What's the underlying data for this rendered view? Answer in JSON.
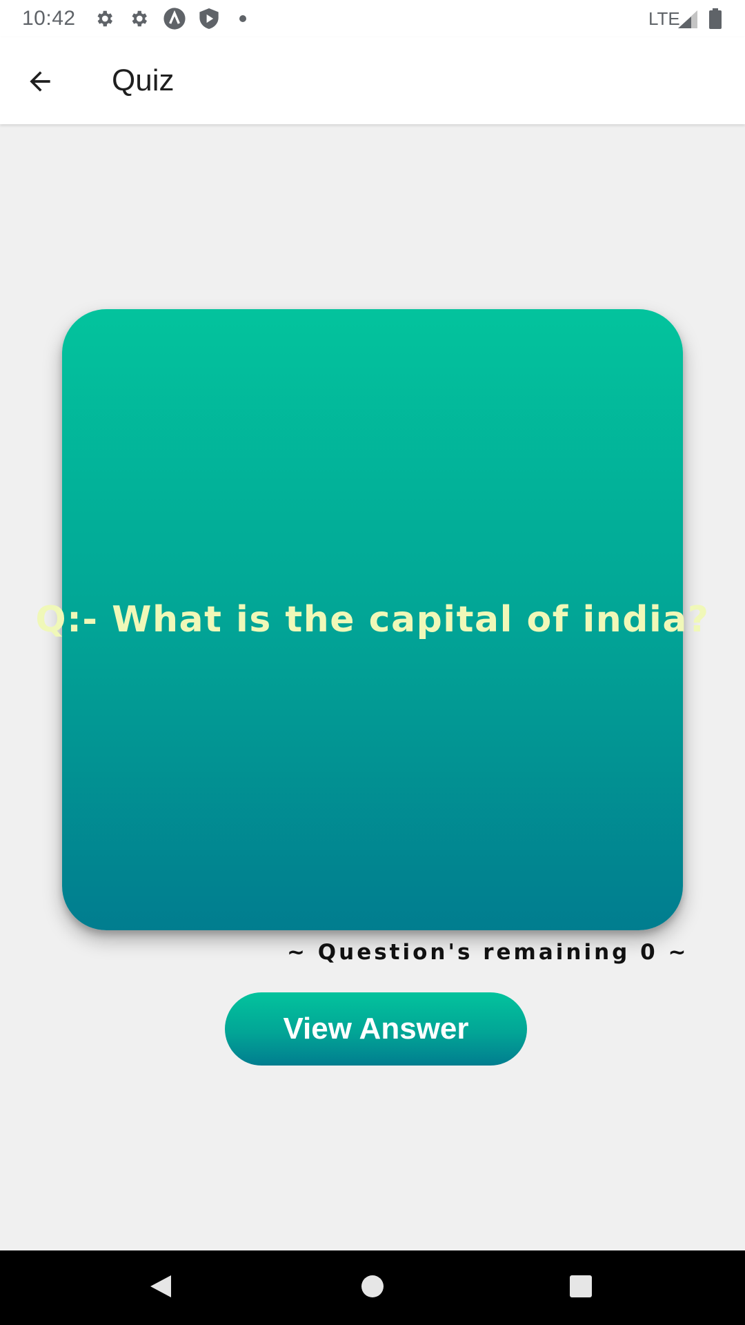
{
  "status_bar": {
    "time": "10:42",
    "network": "LTE",
    "icons": [
      "settings-icon",
      "settings-icon",
      "app-notification-icon",
      "shield-play-icon",
      "dot-icon",
      "signal-icon",
      "battery-icon"
    ]
  },
  "app_bar": {
    "title": "Quiz",
    "back_icon": "arrow-back-icon"
  },
  "card": {
    "question": "Q:- What is the capital of india?",
    "gradient_top": "#03c39d",
    "gradient_bottom": "#017d8f",
    "text_color": "#f0f8b8"
  },
  "remaining": {
    "text": "~ Question's remaining 0 ~"
  },
  "view_answer_button": {
    "label": "View Answer"
  },
  "nav_bar": {
    "icons": [
      "back-triangle-icon",
      "home-circle-icon",
      "recents-square-icon"
    ]
  }
}
